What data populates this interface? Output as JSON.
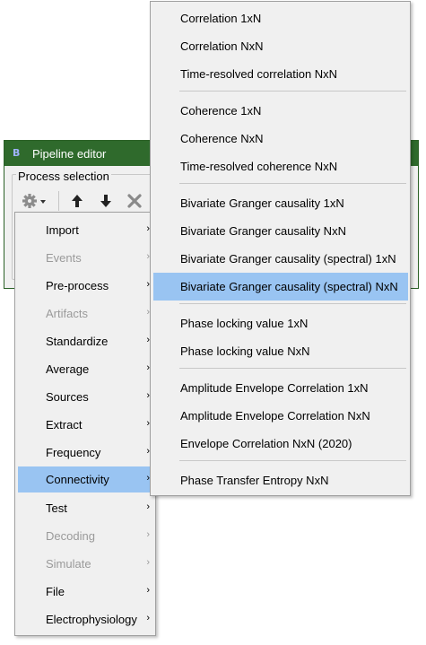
{
  "window": {
    "logo": "B",
    "title": "Pipeline editor",
    "group_label": "Process selection"
  },
  "toolbar": {
    "buttons": [
      {
        "icon": "gear-icon",
        "label": "Add process"
      },
      {
        "icon": "move-up-icon",
        "label": "Move up"
      },
      {
        "icon": "move-down-icon",
        "label": "Move down"
      },
      {
        "icon": "delete-icon",
        "label": "Delete"
      }
    ]
  },
  "main_menu": {
    "items": [
      {
        "label": "Import",
        "enabled": true
      },
      {
        "label": "Events",
        "enabled": false
      },
      {
        "label": "Pre-process",
        "enabled": true
      },
      {
        "label": "Artifacts",
        "enabled": false
      },
      {
        "label": "Standardize",
        "enabled": true
      },
      {
        "label": "Average",
        "enabled": true
      },
      {
        "label": "Sources",
        "enabled": true
      },
      {
        "label": "Extract",
        "enabled": true
      },
      {
        "label": "Frequency",
        "enabled": true
      },
      {
        "label": "Connectivity",
        "enabled": true,
        "selected": true
      },
      {
        "label": "Test",
        "enabled": true
      },
      {
        "label": "Decoding",
        "enabled": false
      },
      {
        "label": "Simulate",
        "enabled": false
      },
      {
        "label": "File",
        "enabled": true
      },
      {
        "label": "Electrophysiology",
        "enabled": true
      }
    ],
    "arrow_glyph": "›"
  },
  "sub_menu": {
    "items": [
      {
        "label": "Correlation 1xN"
      },
      {
        "label": "Correlation NxN"
      },
      {
        "label": "Time-resolved correlation NxN"
      },
      {
        "label": "Coherence 1xN"
      },
      {
        "label": "Coherence NxN"
      },
      {
        "label": "Time-resolved coherence NxN"
      },
      {
        "label": "Bivariate Granger causality 1xN"
      },
      {
        "label": "Bivariate Granger causality NxN"
      },
      {
        "label": "Bivariate Granger causality (spectral) 1xN"
      },
      {
        "label": "Bivariate Granger causality (spectral) NxN",
        "selected": true
      },
      {
        "label": "Phase locking value 1xN"
      },
      {
        "label": "Phase locking value NxN"
      },
      {
        "label": "Amplitude Envelope Correlation 1xN"
      },
      {
        "label": "Amplitude Envelope Correlation NxN"
      },
      {
        "label": "Envelope Correlation NxN (2020)"
      },
      {
        "label": "Phase Transfer Entropy NxN"
      }
    ]
  },
  "colors": {
    "titlebar": "#2f6a2c",
    "menu_bg": "#f0f0f0",
    "highlight": "#99c4f2",
    "disabled_text": "#9a9a9a"
  }
}
